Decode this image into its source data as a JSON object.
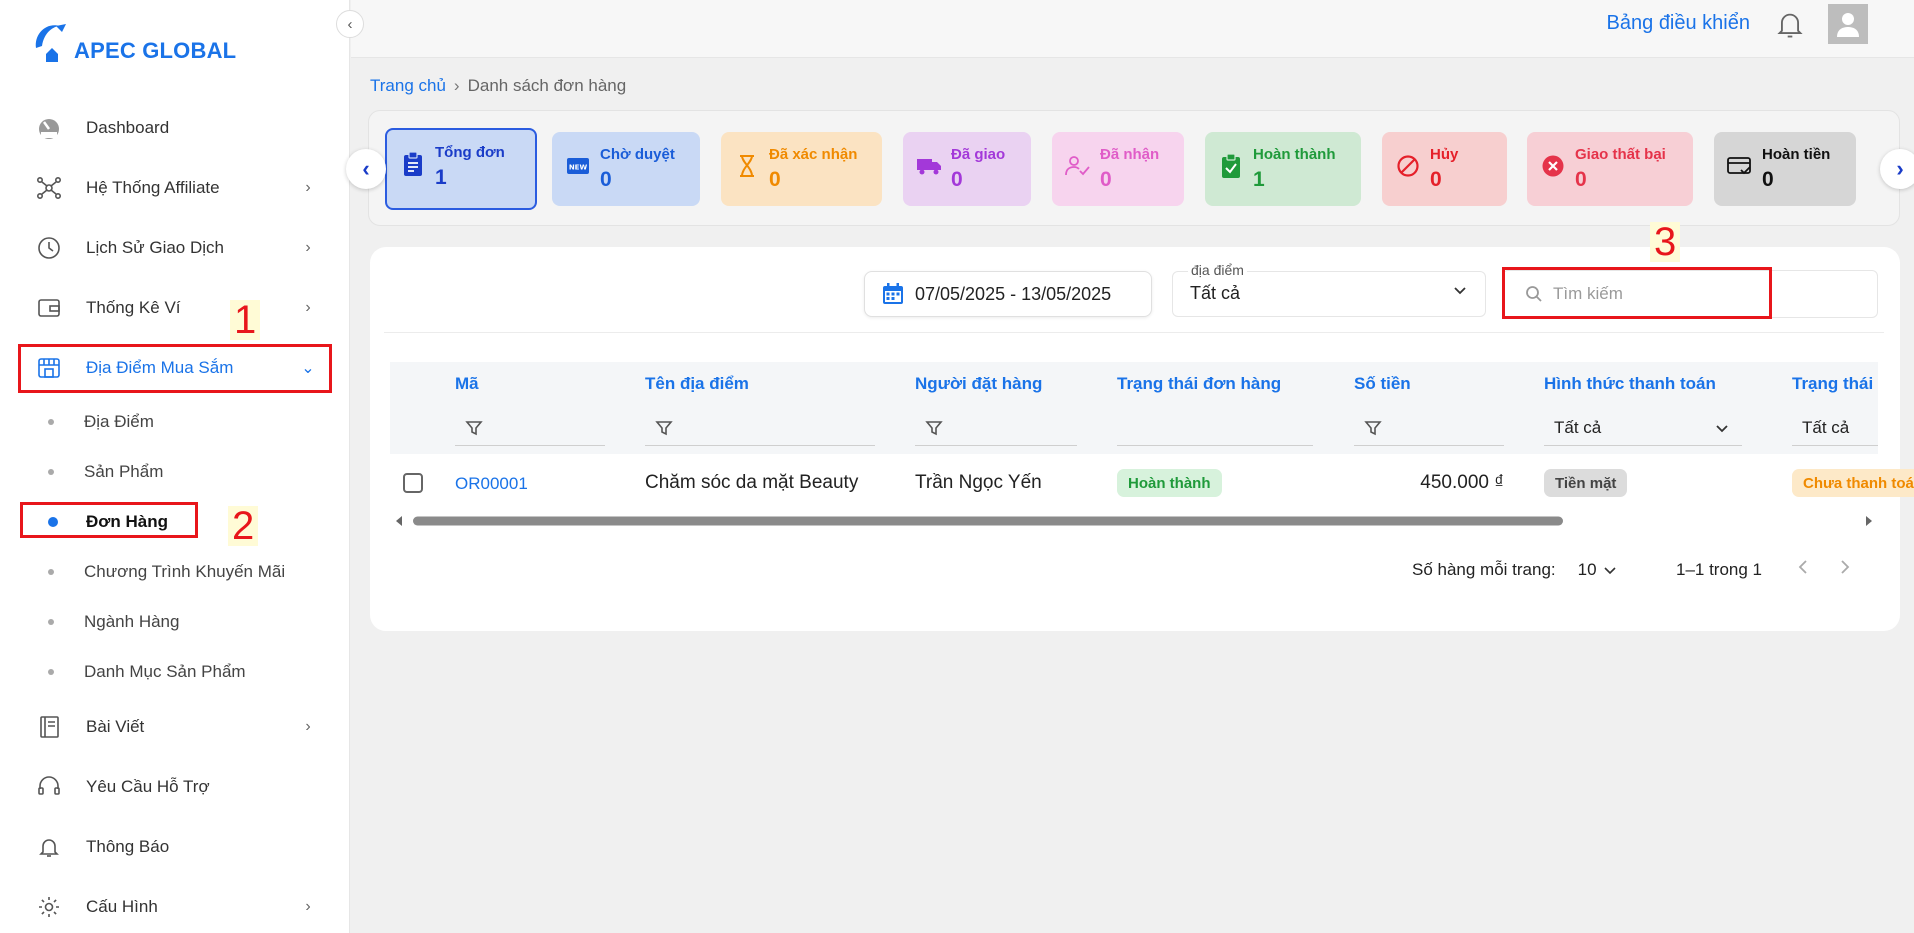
{
  "brand": {
    "name": "APEC GLOBAL",
    "blue": "#1a73e8",
    "red": "#e8161b"
  },
  "header": {
    "dashboard_link": "Bảng điều khiển",
    "bell_icon": "bell-icon",
    "avatar_icon": "user-avatar-icon"
  },
  "sidebar": {
    "items": [
      {
        "label": "Dashboard",
        "icon": "gauge-icon"
      },
      {
        "label": "Hệ Thống Affiliate",
        "icon": "network-icon"
      },
      {
        "label": "Lịch Sử Giao Dịch",
        "icon": "clock-icon"
      },
      {
        "label": "Thống Kê Ví",
        "icon": "wallet-icon"
      },
      {
        "label": "Địa Điểm Mua Sắm",
        "icon": "store-icon"
      },
      {
        "label": "Bài Viết",
        "icon": "notebook-icon"
      },
      {
        "label": "Yêu Cầu Hỗ Trợ",
        "icon": "support-icon"
      },
      {
        "label": "Thông Báo",
        "icon": "bell-icon"
      },
      {
        "label": "Cấu Hình",
        "icon": "gear-icon"
      }
    ],
    "subitems": [
      {
        "label": "Địa Điểm"
      },
      {
        "label": "Sản Phẩm"
      },
      {
        "label": "Đơn Hàng"
      },
      {
        "label": "Chương Trình Khuyến Mãi"
      },
      {
        "label": "Ngành Hàng"
      },
      {
        "label": "Danh Mục Sản Phẩm"
      }
    ]
  },
  "annotations": [
    "1",
    "2",
    "3"
  ],
  "breadcrumb": {
    "home": "Trang chủ",
    "current": "Danh sách đơn hàng"
  },
  "status_cards": [
    {
      "label": "Tổng đơn",
      "count": "1",
      "color": "#1a3cc8",
      "bg": "#c9d9f5",
      "icon": "clipboard-icon"
    },
    {
      "label": "Chờ duyệt",
      "count": "0",
      "color": "#1a5dd8",
      "bg": "#c9d9f5",
      "icon": "new-badge-icon"
    },
    {
      "label": "Đã xác nhận",
      "count": "0",
      "color": "#f08a00",
      "bg": "#fbe3c2",
      "icon": "hourglass-icon"
    },
    {
      "label": "Đã giao",
      "count": "0",
      "color": "#a338d9",
      "bg": "#ead2f2",
      "icon": "truck-icon"
    },
    {
      "label": "Đã nhận",
      "count": "0",
      "color": "#e05cc8",
      "bg": "#f7d4ee",
      "icon": "user-check-icon"
    },
    {
      "label": "Hoàn thành",
      "count": "1",
      "color": "#1f9a3a",
      "bg": "#cfe9d3",
      "icon": "clipboard-check-icon"
    },
    {
      "label": "Hủy",
      "count": "0",
      "color": "#e5202a",
      "bg": "#f7cfcf",
      "icon": "ban-icon"
    },
    {
      "label": "Giao thất bại",
      "count": "0",
      "color": "#e5334a",
      "bg": "#f7cfd5",
      "icon": "x-circle-icon"
    },
    {
      "label": "Hoàn tiền",
      "count": "0",
      "color": "#111111",
      "bg": "#d6d6d6",
      "icon": "card-check-icon"
    }
  ],
  "filters": {
    "date_range": "07/05/2025 - 13/05/2025",
    "place_label": "địa điểm",
    "place_value": "Tất cả",
    "search_placeholder": "Tìm kiếm"
  },
  "table": {
    "columns": [
      "Mã",
      "Tên địa điểm",
      "Người đặt hàng",
      "Trạng thái đơn hàng",
      "Số tiền",
      "Hình thức thanh toán",
      "Trạng thái"
    ],
    "payment_filter": "Tất cả",
    "status_filter": "Tất cả",
    "rows": [
      {
        "code": "OR00001",
        "place": "Chăm sóc da mặt Beauty",
        "customer": "Trần Ngọc Yến",
        "order_status": "Hoàn thành",
        "amount": "450.000 ₫",
        "payment": "Tiền mặt",
        "payment_status": "Chưa thanh toán"
      }
    ]
  },
  "pagination": {
    "rows_label": "Số hàng mỗi trang:",
    "rows_value": "10",
    "range": "1–1 trong 1"
  }
}
